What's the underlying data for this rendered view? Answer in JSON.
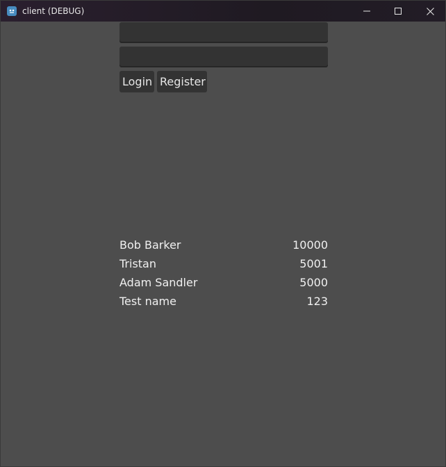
{
  "window": {
    "title": "client (DEBUG)",
    "icon": "godot-icon",
    "controls": {
      "minimize_glyph": "—",
      "maximize_glyph": "☐",
      "close_glyph": "✕"
    }
  },
  "login_form": {
    "username_value": "",
    "password_value": "",
    "login_label": "Login",
    "register_label": "Register"
  },
  "leaderboard": {
    "rows": [
      {
        "name": "Bob Barker",
        "score": "10000"
      },
      {
        "name": "Tristan",
        "score": "5001"
      },
      {
        "name": "Adam Sandler",
        "score": "5000"
      },
      {
        "name": "Test name",
        "score": "123"
      }
    ]
  },
  "colors": {
    "background": "#4d4d4d",
    "control": "#333333",
    "titlebar": "#221c26",
    "text": "#f0f0f0"
  }
}
